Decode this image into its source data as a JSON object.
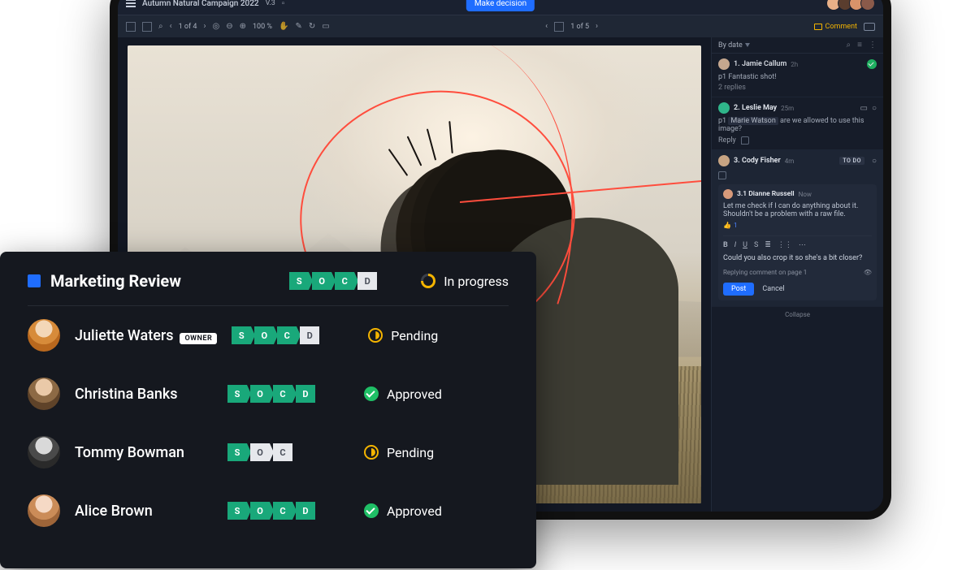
{
  "header": {
    "doc_title": "Autumn Natural Campaign 2022",
    "version": "V.3",
    "make_decision": "Make decision"
  },
  "toolbar": {
    "page_of_set": "1 of 4",
    "zoom": "100 %",
    "slide_of": "1 of 5",
    "comment_label": "Comment"
  },
  "comments": {
    "sort_label": "By date",
    "c1": {
      "num": "1.",
      "name": "Jamie Callum",
      "time": "2h",
      "body": "Fantastic shot!",
      "replies": "2 replies"
    },
    "c2": {
      "num": "2.",
      "name": "Leslie May",
      "time": "25m",
      "mention": "Marie Watson",
      "body": "are we allowed to use this image?",
      "reply_label": "Reply"
    },
    "c3": {
      "num": "3.",
      "name": "Cody Fisher",
      "time": "4m",
      "badge": "TO DO",
      "r1_num": "3.1",
      "r1_name": "Dianne Russell",
      "r1_time": "Now",
      "r1_body": "Let me check if I can do anything about it. Shouldn't be a problem with a raw file.",
      "like_count": "1",
      "draft": "Could you also crop it so she's a bit closer?",
      "footer_note": "Replying comment on page 1",
      "post": "Post",
      "cancel": "Cancel",
      "collapse": "Collapse"
    }
  },
  "review": {
    "title": "Marketing Review",
    "owner_tag": "OWNER",
    "stages": {
      "s": "S",
      "o": "O",
      "c": "C",
      "d": "D"
    },
    "status": {
      "in_progress": "In progress",
      "pending": "Pending",
      "approved": "Approved"
    },
    "people": {
      "p1": "Juliette Waters",
      "p2": "Christina Banks",
      "p3": "Tommy Bowman",
      "p4": "Alice Brown"
    }
  }
}
